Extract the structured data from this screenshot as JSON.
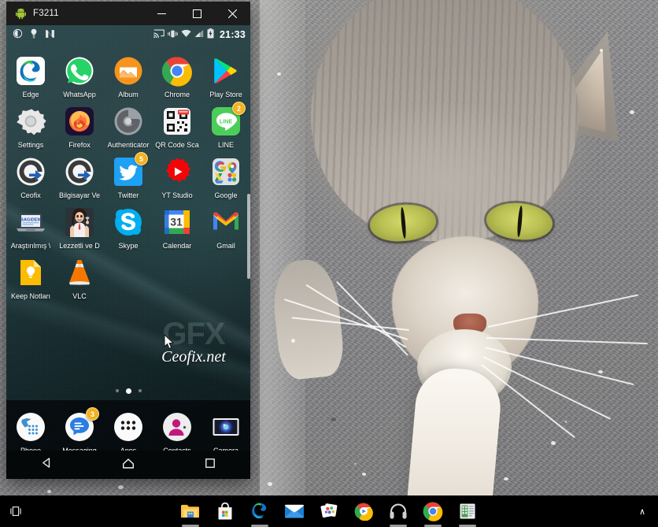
{
  "window": {
    "title": "F3211",
    "icon": "android-robot-icon",
    "minimize_label": "—",
    "maximize_label": "□",
    "close_label": "✕"
  },
  "statusbar": {
    "left_icons": [
      "do-not-disturb-icon",
      "flashlight-icon",
      "nfc-icon"
    ],
    "right_icons": [
      "cast-icon",
      "vibrate-icon",
      "wifi-icon",
      "signal-icon",
      "battery-icon"
    ],
    "clock": "21:33"
  },
  "apps": [
    [
      {
        "label": "Edge",
        "icon": "edge-icon",
        "badge": null
      },
      {
        "label": "WhatsApp",
        "icon": "whatsapp-icon",
        "badge": null
      },
      {
        "label": "Album",
        "icon": "album-icon",
        "badge": null
      },
      {
        "label": "Chrome",
        "icon": "chrome-icon",
        "badge": null
      },
      {
        "label": "Play Store",
        "icon": "play-store-icon",
        "badge": null
      }
    ],
    [
      {
        "label": "Settings",
        "icon": "settings-gear-icon",
        "badge": null
      },
      {
        "label": "Firefox",
        "icon": "firefox-icon",
        "badge": null
      },
      {
        "label": "Authenticator",
        "icon": "authenticator-icon",
        "badge": null
      },
      {
        "label": "QR Code Sca",
        "icon": "qr-code-scanner-icon",
        "badge": null
      },
      {
        "label": "LINE",
        "icon": "line-icon",
        "badge": "2"
      }
    ],
    [
      {
        "label": "Ceofix",
        "icon": "ceofix-icon",
        "badge": null
      },
      {
        "label": "Bilgisayar Ve",
        "icon": "ceofix-icon",
        "badge": null
      },
      {
        "label": "Twitter",
        "icon": "twitter-icon",
        "badge": "5"
      },
      {
        "label": "YT Studio",
        "icon": "youtube-studio-icon",
        "badge": null
      },
      {
        "label": "Google",
        "icon": "google-folder-icon",
        "badge": null
      }
    ],
    [
      {
        "label": "Araştırılmış \\",
        "icon": "laptop-bagidem-icon",
        "badge": null
      },
      {
        "label": "Lezzetli ve D",
        "icon": "lezzetli-icon",
        "badge": null
      },
      {
        "label": "Skype",
        "icon": "skype-icon",
        "badge": null
      },
      {
        "label": "Calendar",
        "icon": "calendar-icon",
        "badge": null
      },
      {
        "label": "Gmail",
        "icon": "gmail-icon",
        "badge": null
      }
    ],
    [
      {
        "label": "Keep Notları",
        "icon": "google-keep-icon",
        "badge": null
      },
      {
        "label": "VLC",
        "icon": "vlc-cone-icon",
        "badge": null
      }
    ]
  ],
  "watermark": {
    "logo": "GFX",
    "text": "Ceofix.net"
  },
  "page_indicator": {
    "count": 3,
    "active": 2
  },
  "dock": [
    {
      "label": "Phone",
      "icon": "phone-handset-icon",
      "badge": null
    },
    {
      "label": "Messaging",
      "icon": "messaging-icon",
      "badge": "3"
    },
    {
      "label": "Apps",
      "icon": "app-drawer-icon",
      "badge": null
    },
    {
      "label": "Contacts",
      "icon": "contacts-person-icon",
      "badge": null
    },
    {
      "label": "Camera",
      "icon": "camera-icon",
      "badge": null
    }
  ],
  "navbar": [
    {
      "name": "back-button",
      "icon": "triangle-back-icon"
    },
    {
      "name": "home-button",
      "icon": "home-outline-icon"
    },
    {
      "name": "recents-button",
      "icon": "square-recents-icon"
    }
  ],
  "taskbar": {
    "task_view": "task-view-icon",
    "items": [
      {
        "name": "file-explorer",
        "icon": "folder-icon",
        "running": true
      },
      {
        "name": "microsoft-store",
        "icon": "store-bag-icon",
        "running": false
      },
      {
        "name": "microsoft-edge",
        "icon": "edge-icon",
        "running": true
      },
      {
        "name": "mail",
        "icon": "mail-envelope-icon",
        "running": false
      },
      {
        "name": "photos",
        "icon": "photos-icon",
        "running": false
      },
      {
        "name": "movies-tv",
        "icon": "movies-play-icon",
        "running": false
      },
      {
        "name": "groove-music",
        "icon": "headphones-icon",
        "running": true
      },
      {
        "name": "google-chrome",
        "icon": "chrome-icon",
        "running": true
      },
      {
        "name": "document-app",
        "icon": "document-icon",
        "running": true
      }
    ],
    "show_hidden": "∧"
  },
  "colors": {
    "titlebar_bg": "#1c1c1c",
    "taskbar_bg": "#000000",
    "phone_bg": "#1d3639",
    "badge": "#f3b11e",
    "accent_green": "#a4c639"
  }
}
